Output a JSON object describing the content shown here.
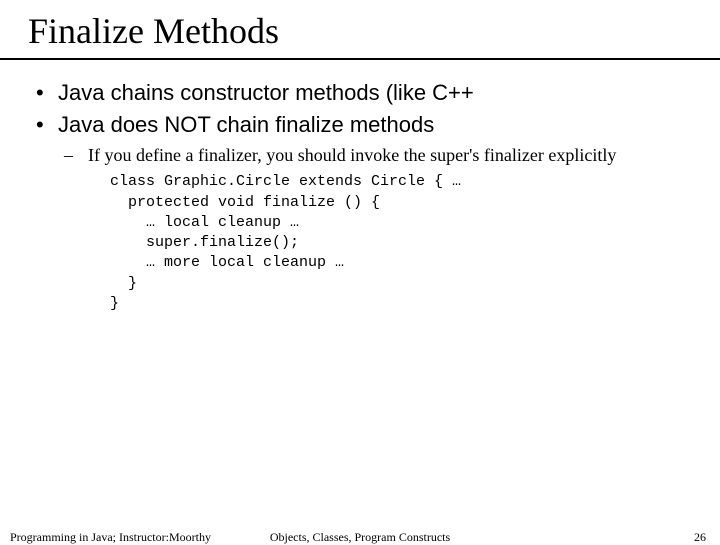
{
  "title": "Finalize Methods",
  "bullets": [
    "Java chains constructor methods (like C++",
    "Java does NOT chain finalize methods"
  ],
  "sub_point": "If you define a finalizer, you should invoke the super's finalizer explicitly",
  "code": "class Graphic.Circle extends Circle { …\n  protected void finalize () {\n    … local cleanup …\n    super.finalize();\n    … more local cleanup …\n  }\n}",
  "footer": {
    "left": "Programming in Java; Instructor:Moorthy",
    "center": "Objects, Classes, Program Constructs",
    "right": "26"
  }
}
